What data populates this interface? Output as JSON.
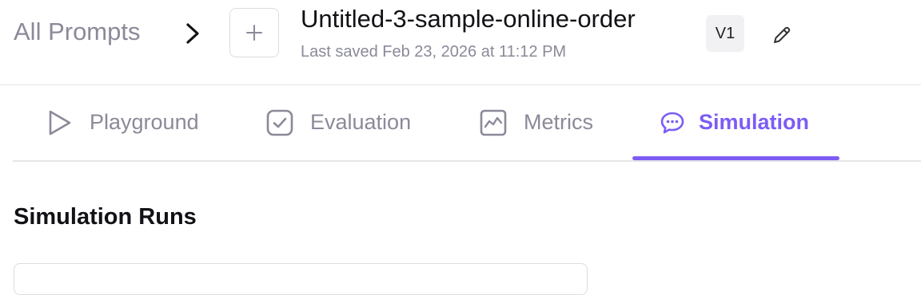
{
  "header": {
    "breadcrumb_root": "All Prompts",
    "prompt_title": "Untitled-3-sample-online-order",
    "last_saved": "Last saved Feb 23, 2026 at 11:12 PM",
    "version": "V1"
  },
  "tabs": [
    {
      "label": "Playground",
      "icon": "play-icon",
      "active": false
    },
    {
      "label": "Evaluation",
      "icon": "check-square-icon",
      "active": false
    },
    {
      "label": "Metrics",
      "icon": "chart-icon",
      "active": false
    },
    {
      "label": "Simulation",
      "icon": "chat-bubble-icon",
      "active": true
    }
  ],
  "colors": {
    "accent": "#7c5cf5",
    "muted_text": "#8a8a99",
    "border": "#e6e6e9"
  },
  "main": {
    "section_title": "Simulation Runs"
  }
}
